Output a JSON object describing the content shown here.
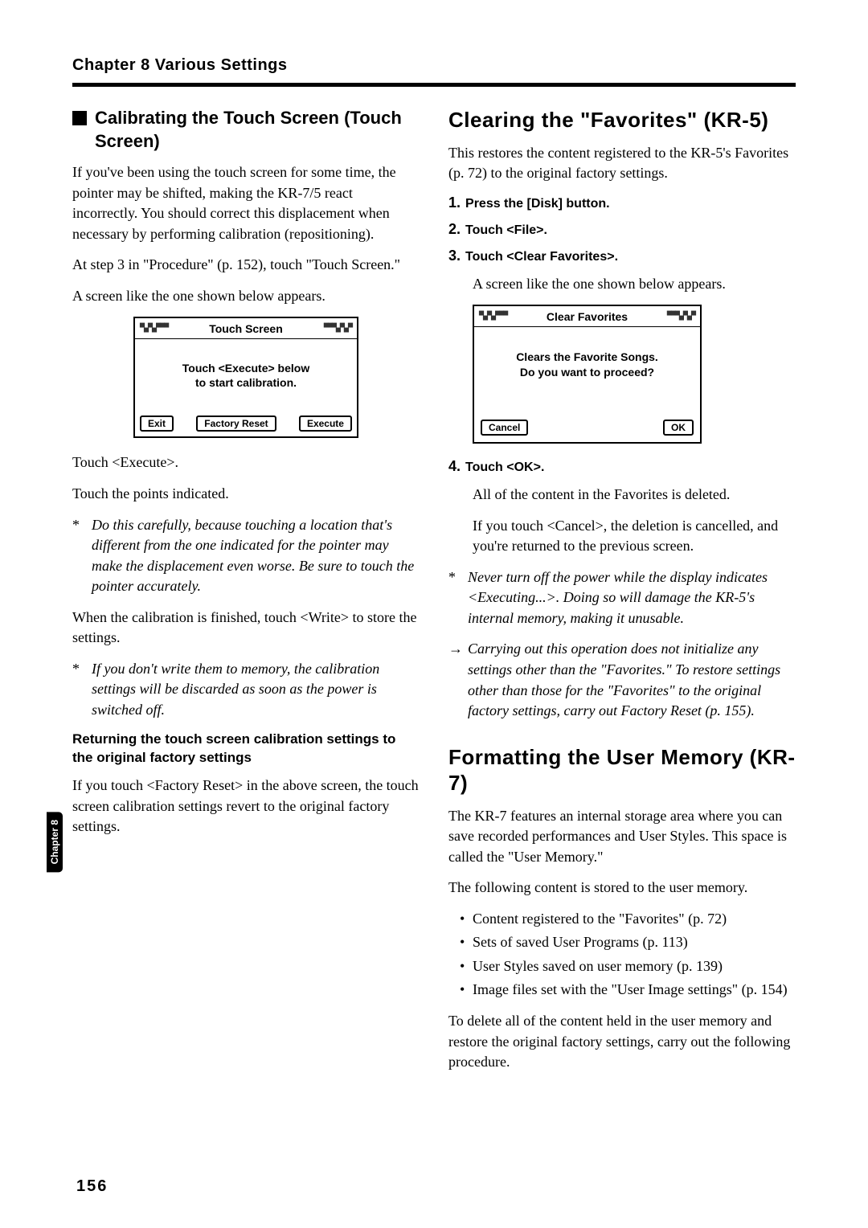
{
  "header": {
    "chapter": "Chapter 8  Various Settings"
  },
  "left": {
    "h1": "Calibrating the Touch Screen (Touch Screen)",
    "p1": "If you've been using the touch screen for some time, the pointer may be shifted, making the KR-7/5 react incorrectly. You should correct this displacement when necessary by performing calibration (repositioning).",
    "p2": "At step 3 in \"Procedure\" (p. 152), touch \"Touch Screen.\"",
    "p3": "A screen like the one shown below appears.",
    "screen1": {
      "title": "Touch Screen",
      "body_l1": "Touch <Execute> below",
      "body_l2": "to start calibration.",
      "btn_exit": "Exit",
      "btn_reset": "Factory Reset",
      "btn_exec": "Execute"
    },
    "p4": "Touch <Execute>.",
    "p5": "Touch the points indicated.",
    "note1": "Do this carefully, because touching a location that's different from the one indicated for the pointer may make the displacement even worse. Be sure to touch the pointer accurately.",
    "p6": "When the calibration is finished, touch <Write> to store the settings.",
    "note2": "If you don't write them to memory, the calibration settings will be discarded as soon as the power is switched off.",
    "h2": "Returning the touch screen calibration settings to the original factory settings",
    "p7": "If you touch <Factory Reset> in the above screen, the touch screen calibration settings revert to the original factory settings."
  },
  "right": {
    "h1": "Clearing the \"Favorites\" (KR-5)",
    "p1": "This restores the content registered to the KR-5's Favorites (p. 72) to the original factory settings.",
    "step1": "Press the [Disk] button.",
    "step2": "Touch <File>.",
    "step3": "Touch <Clear Favorites>.",
    "step3_f": "A screen like the one shown below appears.",
    "screen2": {
      "title": "Clear Favorites",
      "body_l1": "Clears the Favorite Songs.",
      "body_l2": "Do you want to proceed?",
      "btn_cancel": "Cancel",
      "btn_ok": "OK"
    },
    "step4": "Touch <OK>.",
    "step4_f1": "All of the content in the Favorites is deleted.",
    "step4_f2": "If you touch <Cancel>, the deletion is cancelled, and you're returned to the previous screen.",
    "note1": "Never turn off the power while the display indicates <Executing...>. Doing so will damage the KR-5's internal memory, making it unusable.",
    "note2": "Carrying out this operation does not initialize any settings other than the \"Favorites.\" To restore settings other than those for the \"Favorites\" to the original factory settings, carry out Factory Reset (p. 155).",
    "h2": "Formatting the User Memory (KR-7)",
    "p2": "The KR-7 features an internal storage area where you can save recorded performances and User Styles. This space is called the \"User Memory.\"",
    "p3": "The following content is stored to the user memory.",
    "li1": "Content registered to the \"Favorites\" (p. 72)",
    "li2": "Sets of saved User Programs (p. 113)",
    "li3": "User Styles saved on user memory (p. 139)",
    "li4": "Image files set with the \"User Image settings\" (p. 154)",
    "p4": "To delete all of the content held in the user memory and restore the original factory settings, carry out the following procedure."
  },
  "sidetab": "Chapter 8",
  "page": "156"
}
